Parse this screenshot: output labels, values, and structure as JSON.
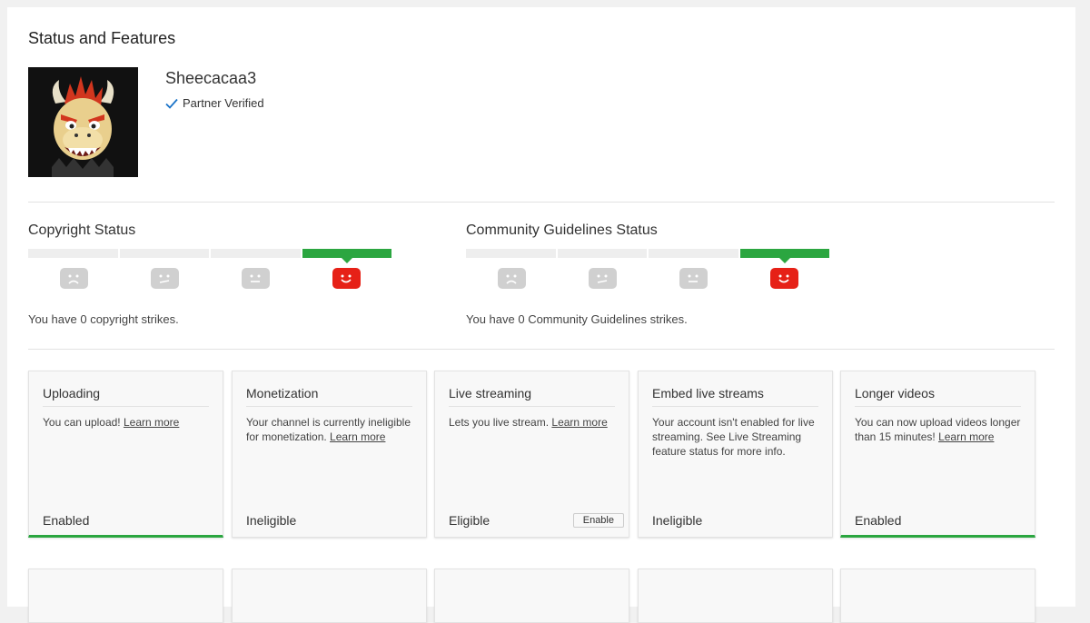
{
  "page": {
    "title": "Status and Features"
  },
  "channel": {
    "name": "Sheecacaa3",
    "verified_label": "Partner Verified"
  },
  "copyright": {
    "title": "Copyright Status",
    "message": "You have 0 copyright strikes."
  },
  "community": {
    "title": "Community Guidelines Status",
    "message": "You have 0 Community Guidelines strikes."
  },
  "features": [
    {
      "title": "Uploading",
      "desc_text": "You can upload! ",
      "link": "Learn more",
      "desc_after": "",
      "status": "Enabled",
      "enabled": true
    },
    {
      "title": "Monetization",
      "desc_text": "Your channel is currently ineligible for monetization. ",
      "link": "Learn more",
      "desc_after": "",
      "status": "Ineligible",
      "enabled": false
    },
    {
      "title": "Live streaming",
      "desc_text": "Lets you live stream. ",
      "link": "Learn more",
      "desc_after": "",
      "status": "Eligible",
      "enabled": false,
      "button": "Enable"
    },
    {
      "title": "Embed live streams",
      "desc_text": "Your account isn't enabled for live streaming. See Live Streaming feature status for more info.",
      "link": "",
      "desc_after": "",
      "status": "Ineligible",
      "enabled": false
    },
    {
      "title": "Longer videos",
      "desc_text": "You can now upload videos longer than 15 minutes! ",
      "link": "Learn more",
      "desc_after": "",
      "status": "Enabled",
      "enabled": true
    }
  ],
  "colors": {
    "accent_green": "#2ba640",
    "good_face_red": "#e62117",
    "inactive_face": "#d0d0d0"
  }
}
